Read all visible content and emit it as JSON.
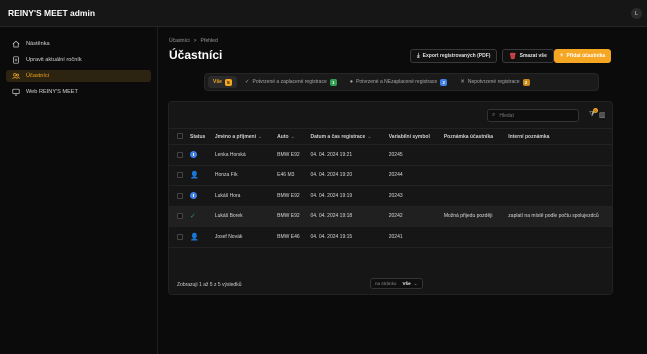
{
  "app": {
    "title": "REINY'S MEET admin",
    "user_initial": "L"
  },
  "sidebar": {
    "items": [
      {
        "label": "Nástěnka",
        "icon": "home-icon"
      },
      {
        "label": "Upravit aktuální ročník",
        "icon": "document-icon"
      },
      {
        "label": "Účastníci",
        "icon": "users-icon",
        "active": true
      },
      {
        "label": "Web REINY'S MEET",
        "icon": "monitor-icon"
      }
    ]
  },
  "breadcrumb": {
    "items": [
      "Účastníci",
      "Přehled"
    ],
    "separator": ">"
  },
  "page": {
    "title": "Účastníci"
  },
  "toolbar": {
    "export_label": "Export registrovaných (PDF)",
    "delete_label": "Smazat vše",
    "add_label": "Přidat účastníka"
  },
  "filters": [
    {
      "label": "Vše",
      "count": "5",
      "active": true,
      "badge_color": "#f5a623"
    },
    {
      "label": "Potvrzené a zaplacené registrace",
      "count": "1",
      "icon": "✓",
      "badge_color": "#2e9e4f"
    },
    {
      "label": "Potvrzené a NEzaplacené registrace",
      "count": "2",
      "icon": "●",
      "badge_color": "#3f7fe6"
    },
    {
      "label": "Nepotvrzené registrace",
      "count": "2",
      "icon": "✕",
      "badge_color": "#c98a1a"
    }
  ],
  "search": {
    "placeholder": "Hledat"
  },
  "table": {
    "filter_count": "0",
    "columns": [
      "Status",
      "Jméno a příjmení",
      "Auto",
      "Datum a čas registrace",
      "Variabilní symbol",
      "Poznámka účastníka",
      "Interní poznámka"
    ],
    "rows": [
      {
        "status": "clock",
        "name": "Lenka Horská",
        "auto": "BMW E92",
        "datetime": "04. 04. 2024 19:21",
        "vs": "20245",
        "note": "",
        "internal": ""
      },
      {
        "status": "user",
        "name": "Honza Fík",
        "auto": "E46 M3",
        "datetime": "04. 04. 2024 19:20",
        "vs": "20244",
        "note": "",
        "internal": ""
      },
      {
        "status": "clock",
        "name": "Lukáš Hora",
        "auto": "BMW E92",
        "datetime": "04. 04. 2024 19:19",
        "vs": "20243",
        "note": "",
        "internal": ""
      },
      {
        "status": "check",
        "name": "Lukáš Borek",
        "auto": "BMW E92",
        "datetime": "04. 04. 2024 19:18",
        "vs": "20242",
        "note": "Možná přijedu později",
        "internal": "zaplatí na místě podle počtu spolujezdců"
      },
      {
        "status": "user",
        "name": "Josef Novák",
        "auto": "BMW E46",
        "datetime": "04. 04. 2024 19:15",
        "vs": "20241",
        "note": "",
        "internal": ""
      }
    ]
  },
  "footer": {
    "summary": "Zobrazuji 1 až 5 z 5 výsledků",
    "per_page_label": "na stránku",
    "per_page_value": "Vše"
  },
  "colors": {
    "accent": "#f5a623",
    "danger": "#e5484d",
    "success": "#2e9e4f",
    "info": "#3f7fe6"
  }
}
